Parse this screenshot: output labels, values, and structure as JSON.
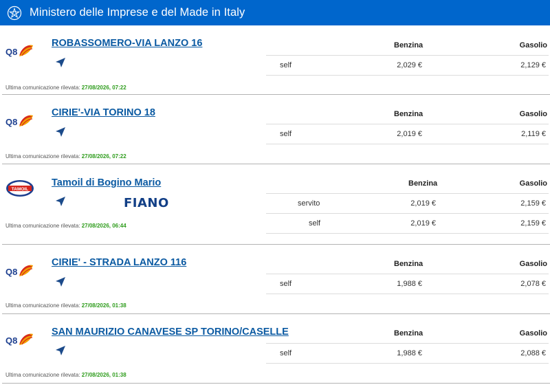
{
  "header": {
    "title": "Ministero delle Imprese e del Made in Italy"
  },
  "labels": {
    "last_comm": "Ultima comunicazione rilevata:"
  },
  "stations": [
    {
      "brand_logo": "q8-logo",
      "name": "ROBASSOMERO-VIA LANZO 16",
      "fuel_headers": [
        "Benzina",
        "Gasolio"
      ],
      "rows": [
        {
          "service": "self",
          "benzina": "2,029 €",
          "gasolio": "2,129 €"
        }
      ],
      "timestamp": "27/08/2026, 07:22"
    },
    {
      "brand_logo": "q8-logo",
      "name": "CIRIE'-VIA TORINO 18",
      "fuel_headers": [
        "Benzina",
        "Gasolio"
      ],
      "rows": [
        {
          "service": "self",
          "benzina": "2,019 €",
          "gasolio": "2,119 €"
        }
      ],
      "timestamp": "27/08/2026, 07:22"
    },
    {
      "brand_logo": "tamoil-logo",
      "brand_logo_text": "TAMOIL",
      "name": "Tamoil di Bogino Mario",
      "extra_logo": "FIANO",
      "fuel_headers": [
        "Benzina",
        "Gasolio"
      ],
      "rows": [
        {
          "service": "servito",
          "benzina": "2,019 €",
          "gasolio": "2,159 €"
        },
        {
          "service": "self",
          "benzina": "2,019 €",
          "gasolio": "2,159 €"
        }
      ],
      "timestamp": "27/08/2026, 06:44"
    },
    {
      "brand_logo": "q8-logo",
      "name": "CIRIE' - STRADA LANZO 116",
      "fuel_headers": [
        "Benzina",
        "Gasolio"
      ],
      "rows": [
        {
          "service": "self",
          "benzina": "1,988 €",
          "gasolio": "2,078 €"
        }
      ],
      "timestamp": "27/08/2026, 01:38"
    },
    {
      "brand_logo": "q8-logo",
      "name": "SAN MAURIZIO CANAVESE SP TORINO/CASELLE",
      "fuel_headers": [
        "Benzina",
        "Gasolio"
      ],
      "rows": [
        {
          "service": "self",
          "benzina": "1,988 €",
          "gasolio": "2,088 €"
        }
      ],
      "timestamp": "27/08/2026, 01:38"
    }
  ],
  "colors": {
    "header_bg": "#0066cc",
    "link": "#0b5aa2",
    "timestamp": "#2e9c1c"
  }
}
